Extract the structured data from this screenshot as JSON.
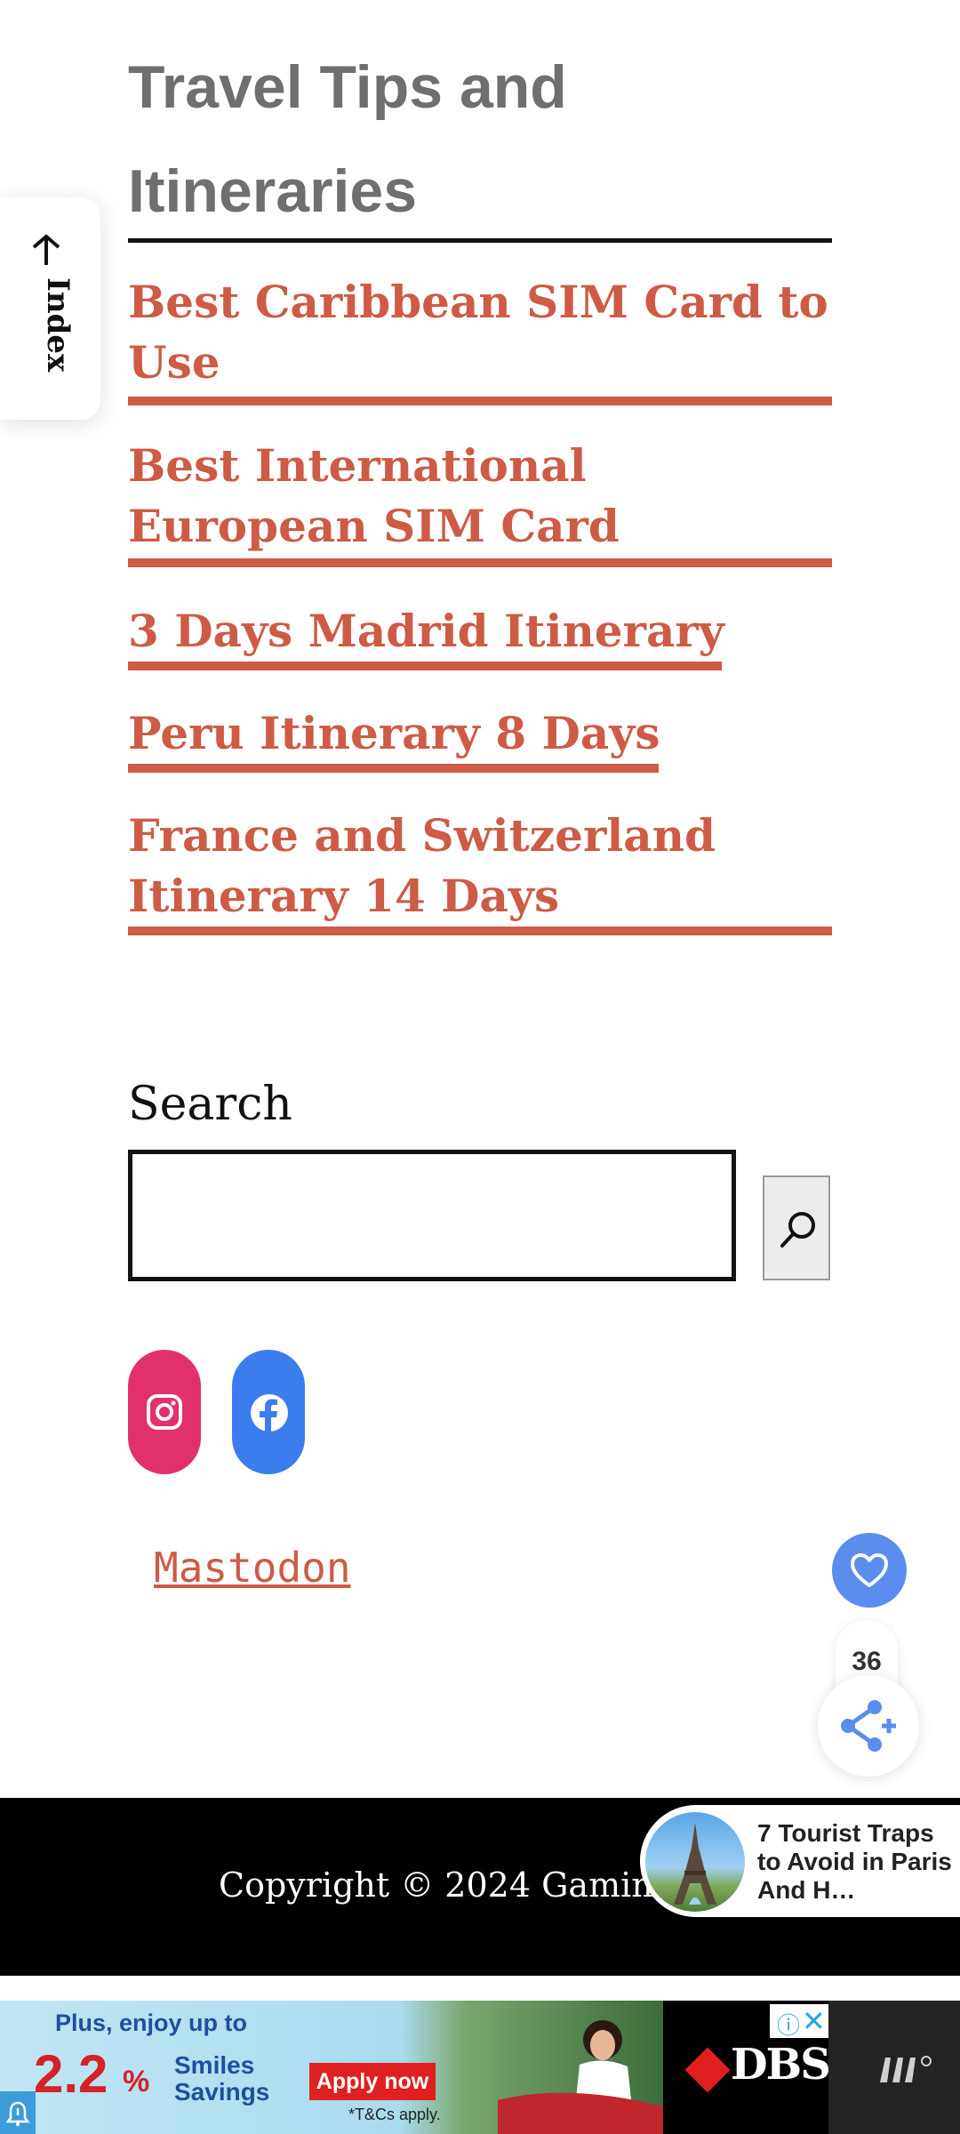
{
  "section": {
    "title": "Travel Tips and Itineraries"
  },
  "index_tab": {
    "label": "Index"
  },
  "posts": [
    {
      "title": "Best Caribbean SIM Card to Use"
    },
    {
      "title": "Best International European SIM Card"
    },
    {
      "title": "3 Days Madrid Itinerary"
    },
    {
      "title": "Peru Itinerary 8 Days"
    },
    {
      "title": "France and Switzerland Itinerary 14 Days"
    }
  ],
  "search": {
    "label": "Search",
    "placeholder": ""
  },
  "social": {
    "mastodon": "Mastodon"
  },
  "widgets": {
    "like_count": "36"
  },
  "footer": {
    "copyright": "Copyright © 2024 Gamintra"
  },
  "recommendation": {
    "title": "7 Tourist Traps to Avoid in Paris And H…"
  },
  "ad": {
    "line1": "Plus, enjoy up to",
    "rate": "2.2",
    "percent": "%",
    "smiles": "Smiles Savings",
    "cta": "Apply now",
    "terms": "*T&Cs apply.",
    "brand": "DBS"
  },
  "colors": {
    "accent": "#cd5b45",
    "heading": "#6f6f6f",
    "instagram": "#e1306c",
    "facebook": "#3b7ded",
    "widget_blue": "#5b8def",
    "footer_bg": "#000000"
  }
}
